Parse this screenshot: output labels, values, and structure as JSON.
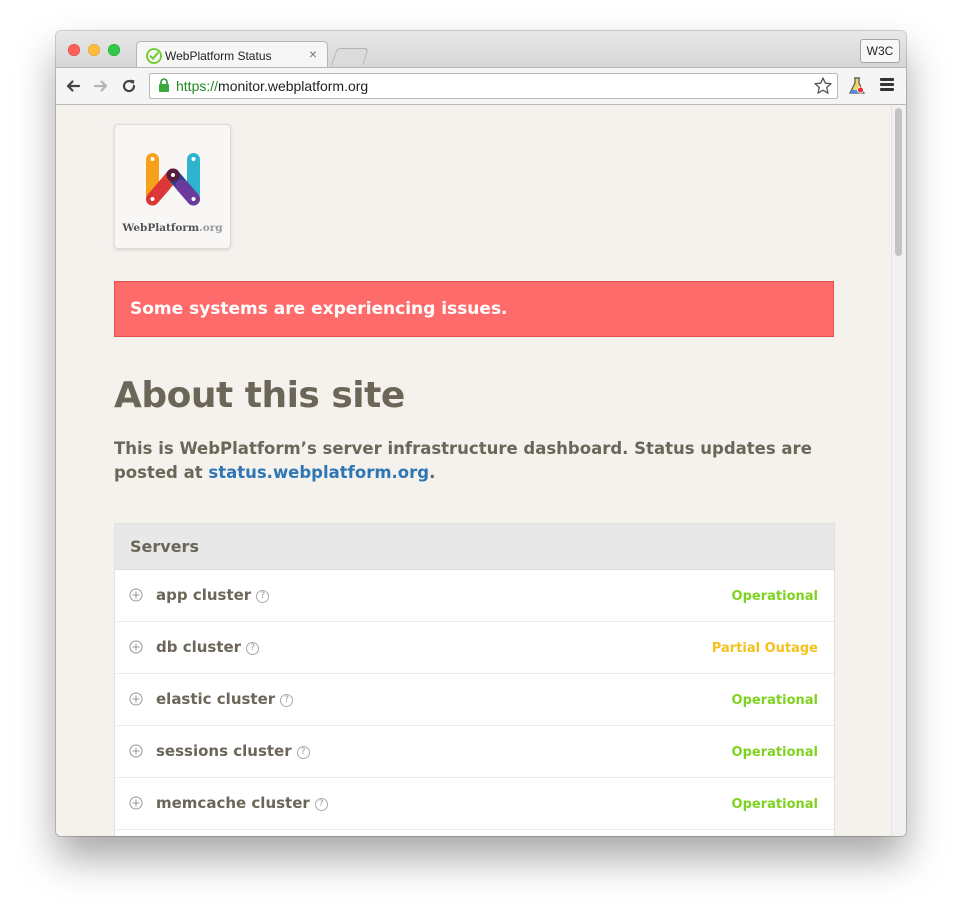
{
  "browser": {
    "tab_title": "WebPlatform Status",
    "tab_close": "×",
    "w3c_button": "W3C",
    "url_scheme": "https://",
    "url_host": "monitor.webplatform.org"
  },
  "page": {
    "logo_name": "WebPlatform",
    "logo_tld": ".org",
    "alert": "Some systems are experiencing issues.",
    "title": "About this site",
    "intro_text": "This is WebPlatform’s server infrastructure dashboard. Status updates are posted at ",
    "intro_link": "status.webplatform.org",
    "intro_end": ".",
    "servers": {
      "header": "Servers",
      "rows": [
        {
          "name": "app cluster",
          "status": "Operational"
        },
        {
          "name": "db cluster",
          "status": "Partial Outage"
        },
        {
          "name": "elastic cluster",
          "status": "Operational"
        },
        {
          "name": "sessions cluster",
          "status": "Operational"
        },
        {
          "name": "memcache cluster",
          "status": "Operational"
        }
      ]
    }
  },
  "colors": {
    "alert_bg": "#ff6b6b",
    "operational": "#7ed321",
    "partial_outage": "#f5c11a",
    "link": "#2f76b4"
  }
}
